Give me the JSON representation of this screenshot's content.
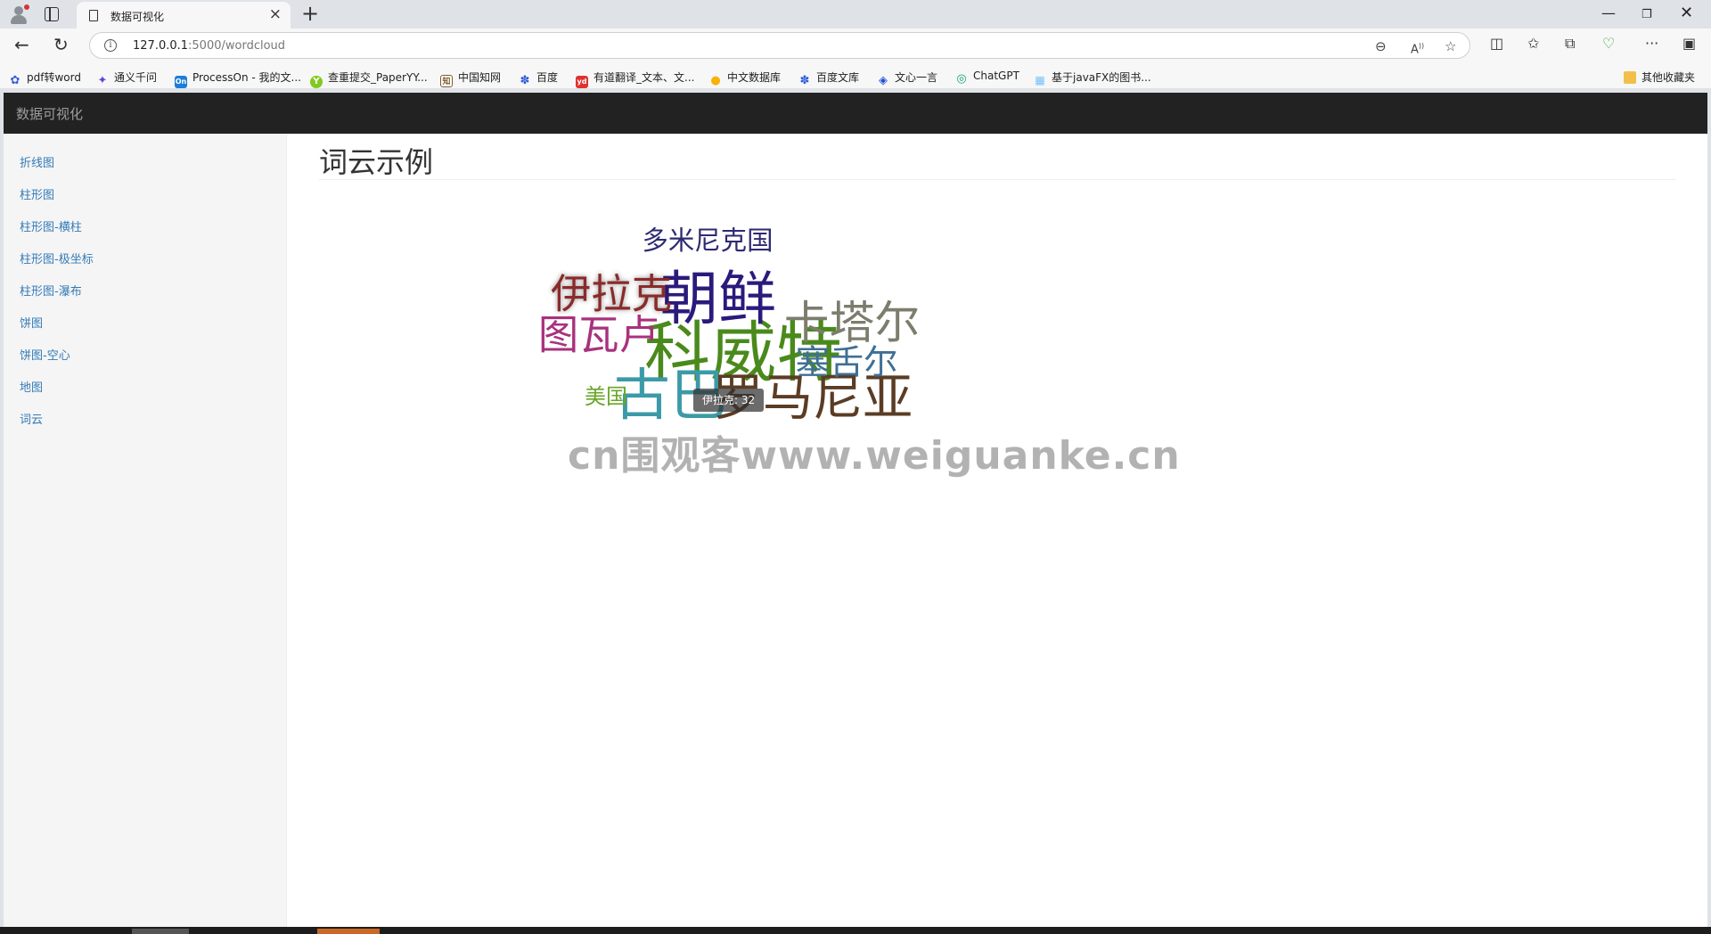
{
  "browser": {
    "tab_title": "数据可视化",
    "url_host": "127.0.0.1",
    "url_path": ":5000/wordcloud",
    "bookmarks": [
      {
        "label": "pdf转word",
        "color": "#3b5bdb",
        "glyph": "✿"
      },
      {
        "label": "通义千问",
        "color": "#6741d9",
        "glyph": "✦"
      },
      {
        "label": "ProcessOn - 我的文...",
        "color": "#1c7ed6",
        "glyph": "On"
      },
      {
        "label": "查重提交_PaperYY...",
        "color": "#82c91e",
        "glyph": "Y"
      },
      {
        "label": "中国知网",
        "color": "#7a5c2e",
        "glyph": "知"
      },
      {
        "label": "百度",
        "color": "#2f5bdb",
        "glyph": "✽"
      },
      {
        "label": "有道翻译_文本、文...",
        "color": "#e03131",
        "glyph": "yd"
      },
      {
        "label": "中文数据库",
        "color": "#fab005",
        "glyph": "●"
      },
      {
        "label": "百度文库",
        "color": "#2f5bdb",
        "glyph": "✽"
      },
      {
        "label": "文心一言",
        "color": "#1c4fd8",
        "glyph": "◈"
      },
      {
        "label": "ChatGPT",
        "color": "#10a37f",
        "glyph": "◎"
      },
      {
        "label": "基于javaFX的图书...",
        "color": "#74c0fc",
        "glyph": "▦"
      }
    ],
    "other_bookmarks": "其他收藏夹"
  },
  "app": {
    "brand": "数据可视化",
    "sidebar": [
      {
        "label": "折线图"
      },
      {
        "label": "柱形图"
      },
      {
        "label": "柱形图-横柱"
      },
      {
        "label": "柱形图-极坐标"
      },
      {
        "label": "柱形图-瀑布"
      },
      {
        "label": "饼图"
      },
      {
        "label": "饼图-空心"
      },
      {
        "label": "地图"
      },
      {
        "label": "词云"
      }
    ],
    "page_title": "词云示例",
    "tooltip": "伊拉克: 32",
    "watermark": "cn围观客www.weiguanke.cn"
  },
  "chart_data": {
    "type": "wordcloud",
    "words": [
      {
        "name": "科威特",
        "value": 48,
        "color": "#4a8a1c"
      },
      {
        "name": "朝鲜",
        "value": 43,
        "color": "#2b1a7c"
      },
      {
        "name": "古巴",
        "value": 42,
        "color": "#3c9aa8"
      },
      {
        "name": "罗马尼亚",
        "value": 38,
        "color": "#5b3c24"
      },
      {
        "name": "卡塔尔",
        "value": 35,
        "color": "#7d7d6e"
      },
      {
        "name": "伊拉克",
        "value": 32,
        "color": "#8b2a2a"
      },
      {
        "name": "图瓦卢",
        "value": 32,
        "color": "#a8327d"
      },
      {
        "name": "塞舌尔",
        "value": 28,
        "color": "#3f6f95"
      },
      {
        "name": "多米尼克国",
        "value": 23,
        "color": "#2e2a72"
      },
      {
        "name": "美国",
        "value": 20,
        "color": "#6aa52a"
      }
    ]
  }
}
